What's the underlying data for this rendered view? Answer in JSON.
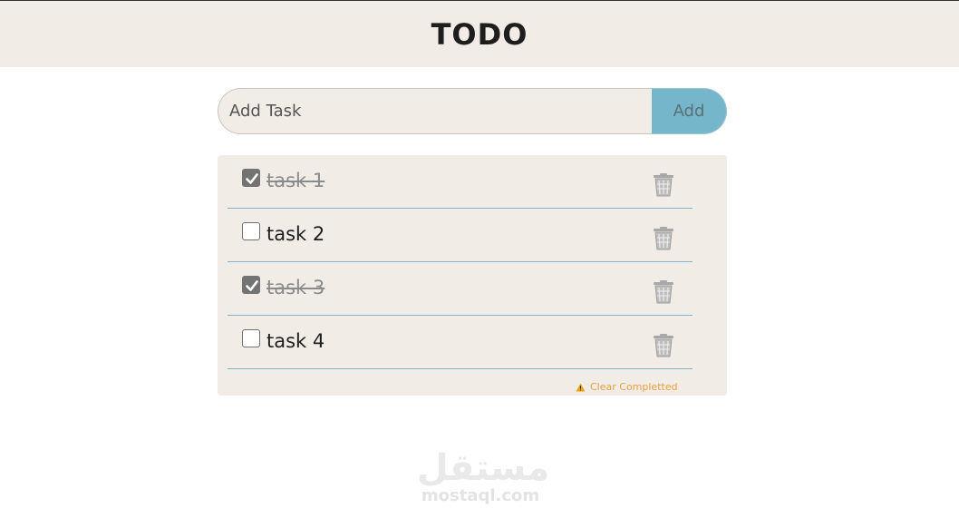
{
  "header": {
    "title": "TODO"
  },
  "add_form": {
    "placeholder": "Add Task",
    "button_label": "Add"
  },
  "tasks": [
    {
      "label": "task 1",
      "done": true
    },
    {
      "label": "task 2",
      "done": false
    },
    {
      "label": "task 3",
      "done": true
    },
    {
      "label": "task 4",
      "done": false
    }
  ],
  "footer": {
    "clear_label": "Clear Completted"
  },
  "watermark": {
    "arabic": "مستقل",
    "latin": "mostaql.com"
  },
  "colors": {
    "header_bg": "#f1ece6",
    "panel_bg": "#f1ece6",
    "add_button_bg": "#76b6cb",
    "divider": "#7fb5cb",
    "warning": "#e8a040"
  }
}
